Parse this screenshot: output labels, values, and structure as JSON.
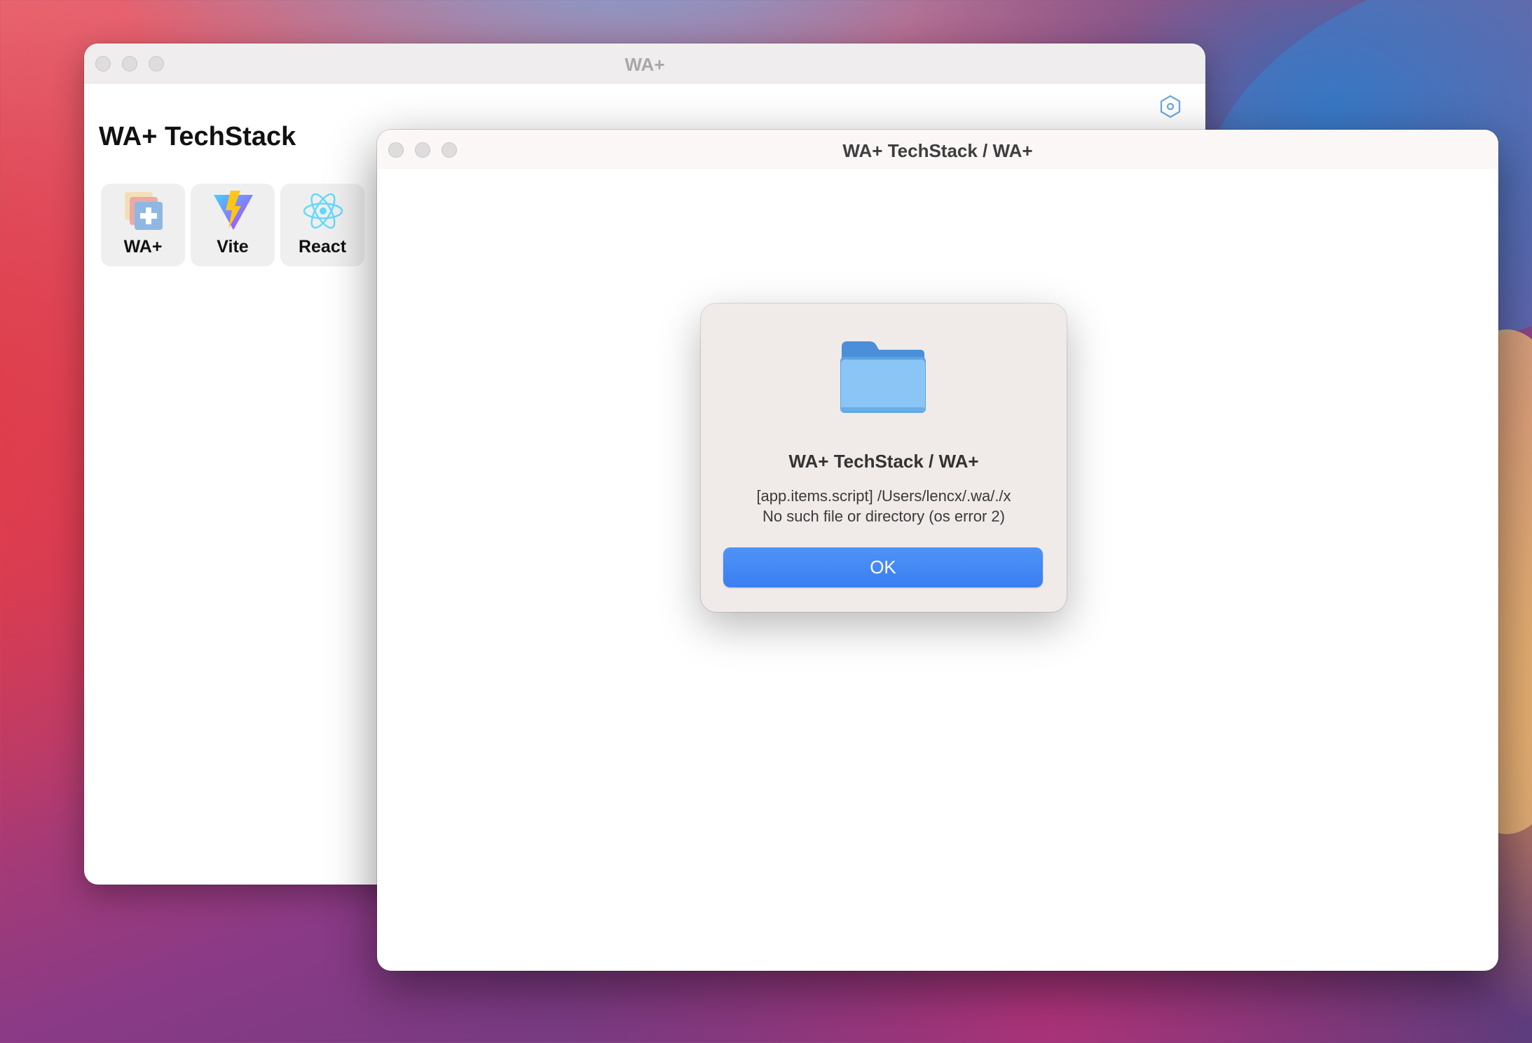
{
  "back_window": {
    "title": "WA+",
    "heading": "WA+ TechStack",
    "settings_icon": "hexagon-settings-icon",
    "apps": [
      {
        "label": "WA+",
        "icon": "wa-plus-icon"
      },
      {
        "label": "Vite",
        "icon": "vite-icon"
      },
      {
        "label": "React",
        "icon": "react-icon"
      }
    ]
  },
  "front_window": {
    "title": "WA+ TechStack / WA+"
  },
  "dialog": {
    "icon": "folder-icon",
    "title": "WA+ TechStack / WA+",
    "message_line1": "[app.items.script] /Users/lencx/.wa/./x",
    "message_line2": "No such file or directory (os error 2)",
    "ok_label": "OK"
  },
  "colors": {
    "accent": "#3a7ef2",
    "react": "#61dafb",
    "vite_purple": "#8c5cf6",
    "vite_yellow": "#ffc517"
  }
}
